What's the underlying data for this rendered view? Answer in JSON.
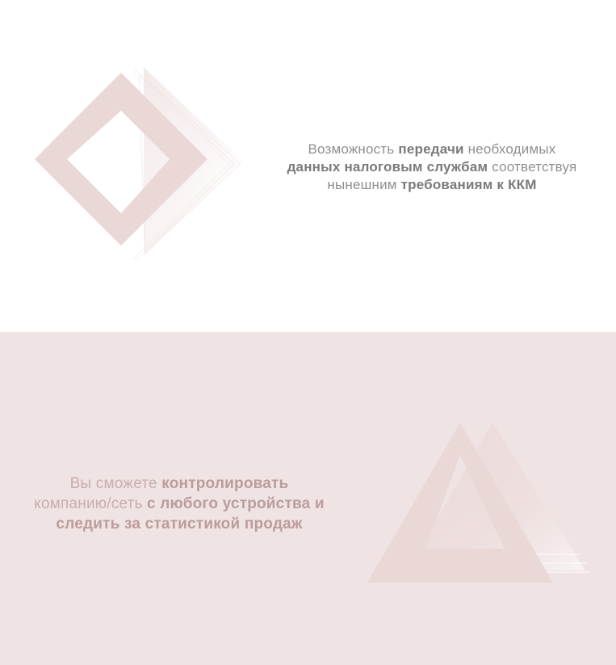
{
  "colors": {
    "top_background": "#ffffff",
    "bottom_background": "#f0e3e3",
    "shape_pink": "#ead8d7",
    "top_text": "#8f8f8f",
    "bottom_text": "#c9adad"
  },
  "top_section": {
    "icon": "diamond-frame-icon",
    "text_lines": [
      [
        {
          "text": "Возможность ",
          "bold": false
        },
        {
          "text": "передачи",
          "bold": true
        },
        {
          "text": " необходимых",
          "bold": false
        }
      ],
      [
        {
          "text": "данных налоговым службам",
          "bold": true
        },
        {
          "text": " соответствуя",
          "bold": false
        }
      ],
      [
        {
          "text": "нынешним ",
          "bold": false
        },
        {
          "text": "требованиям к ККМ",
          "bold": true
        }
      ]
    ]
  },
  "bottom_section": {
    "icon": "triangle-frame-icon",
    "text_lines": [
      [
        {
          "text": "Вы сможете ",
          "bold": false
        },
        {
          "text": "контролировать",
          "bold": true
        }
      ],
      [
        {
          "text": "компанию/сеть ",
          "bold": false
        },
        {
          "text": "с любого устройства и",
          "bold": true
        }
      ],
      [
        {
          "text": "следить за статистикой продаж",
          "bold": true
        }
      ]
    ]
  }
}
